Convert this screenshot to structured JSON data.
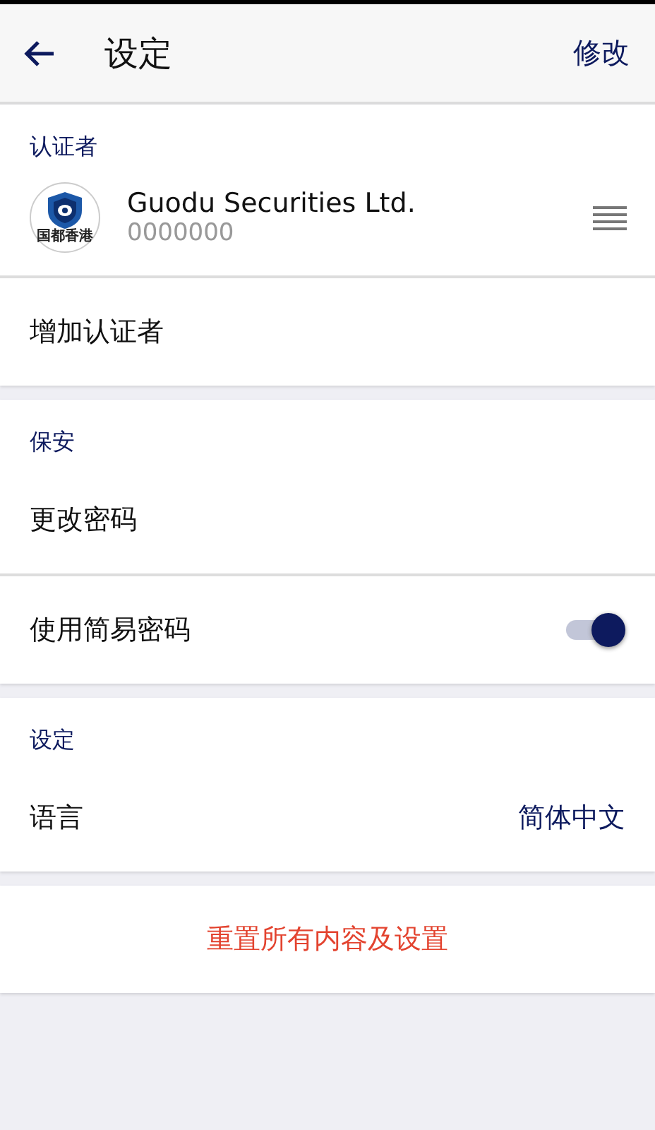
{
  "header": {
    "title": "设定",
    "action": "修改"
  },
  "sections": [
    {
      "title": "认证者",
      "items": [
        {
          "kind": "account",
          "name": "Guodu Securities Ltd.",
          "account": "0000000",
          "logo_text": "国都香港"
        },
        {
          "kind": "action",
          "label": "增加认证者"
        }
      ]
    },
    {
      "title": "保安",
      "items": [
        {
          "kind": "action",
          "label": "更改密码"
        },
        {
          "kind": "toggle",
          "label": "使用简易密码",
          "on": true
        }
      ]
    },
    {
      "title": "设定",
      "items": [
        {
          "kind": "value",
          "label": "语言",
          "value": "简体中文"
        }
      ]
    }
  ],
  "reset_button": "重置所有内容及设置"
}
